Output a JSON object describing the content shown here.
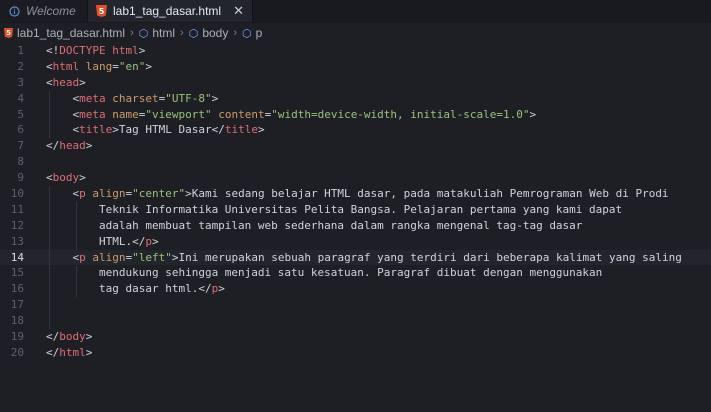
{
  "tabs": [
    {
      "label": "Welcome",
      "active": false,
      "icon": "info-icon"
    },
    {
      "label": "lab1_tag_dasar.html",
      "active": true,
      "icon": "html5-icon"
    }
  ],
  "breadcrumb": [
    "lab1_tag_dasar.html",
    "html",
    "body",
    "p"
  ],
  "current_line": 14,
  "lines": [
    {
      "n": "1",
      "code": "<!DOCTYPE html>"
    },
    {
      "n": "2",
      "code": "<html lang=\"en\">"
    },
    {
      "n": "3",
      "code": "<head>"
    },
    {
      "n": "4",
      "code": "    <meta charset=\"UTF-8\">"
    },
    {
      "n": "5",
      "code": "    <meta name=\"viewport\" content=\"width=device-width, initial-scale=1.0\">"
    },
    {
      "n": "6",
      "code": "    <title>Tag HTML Dasar</title>"
    },
    {
      "n": "7",
      "code": "</head>"
    },
    {
      "n": "8",
      "code": ""
    },
    {
      "n": "9",
      "code": "<body>"
    },
    {
      "n": "10",
      "code": "    <p align=\"center\">Kami sedang belajar HTML dasar, pada matakuliah Pemrograman Web di Prodi"
    },
    {
      "n": "11",
      "code": "        Teknik Informatika Universitas Pelita Bangsa. Pelajaran pertama yang kami dapat"
    },
    {
      "n": "12",
      "code": "        adalah membuat tampilan web sederhana dalam rangka mengenal tag-tag dasar"
    },
    {
      "n": "13",
      "code": "        HTML.</p>"
    },
    {
      "n": "14",
      "code": "    <p align=\"left\">Ini merupakan sebuah paragraf yang terdiri dari beberapa kalimat yang saling"
    },
    {
      "n": "15",
      "code": "        mendukung sehingga menjadi satu kesatuan. Paragraf dibuat dengan menggunakan"
    },
    {
      "n": "16",
      "code": "        tag dasar html.</p>"
    },
    {
      "n": "17",
      "code": ""
    },
    {
      "n": "18",
      "code": ""
    },
    {
      "n": "19",
      "code": "</body>"
    },
    {
      "n": "20",
      "code": "</html>"
    }
  ]
}
